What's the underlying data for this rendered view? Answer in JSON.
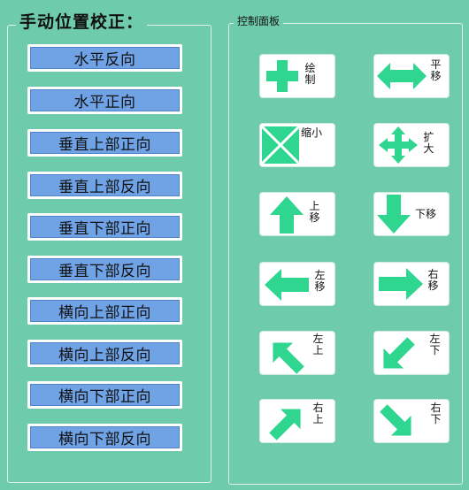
{
  "left_panel": {
    "title": "手动位置校正：",
    "buttons": [
      "水平反向",
      "水平正向",
      "垂直上部正向",
      "垂直上部反向",
      "垂直下部正向",
      "垂直下部反向",
      "横向上部正向",
      "横向上部反向",
      "横向下部正向",
      "横向下部反向"
    ]
  },
  "right_panel": {
    "title": "控制面板",
    "controls": [
      {
        "label": "绘制",
        "icon": "plus-icon"
      },
      {
        "label": "平移",
        "icon": "horizontal-double-arrow-icon"
      },
      {
        "label": "缩小",
        "icon": "shrink-icon"
      },
      {
        "label": "扩大",
        "icon": "four-way-arrow-icon"
      },
      {
        "label": "上移",
        "icon": "arrow-up-icon"
      },
      {
        "label": "下移",
        "icon": "arrow-down-icon"
      },
      {
        "label": "左移",
        "icon": "arrow-left-icon"
      },
      {
        "label": "右移",
        "icon": "arrow-right-icon"
      },
      {
        "label": "左上",
        "icon": "arrow-up-left-icon"
      },
      {
        "label": "左下",
        "icon": "arrow-down-left-icon"
      },
      {
        "label": "右上",
        "icon": "arrow-up-right-icon"
      },
      {
        "label": "右下",
        "icon": "arrow-down-right-icon"
      }
    ]
  },
  "colors": {
    "background": "#6ecbac",
    "button_fill": "#6fa3e6",
    "icon_green": "#2fd68f"
  }
}
